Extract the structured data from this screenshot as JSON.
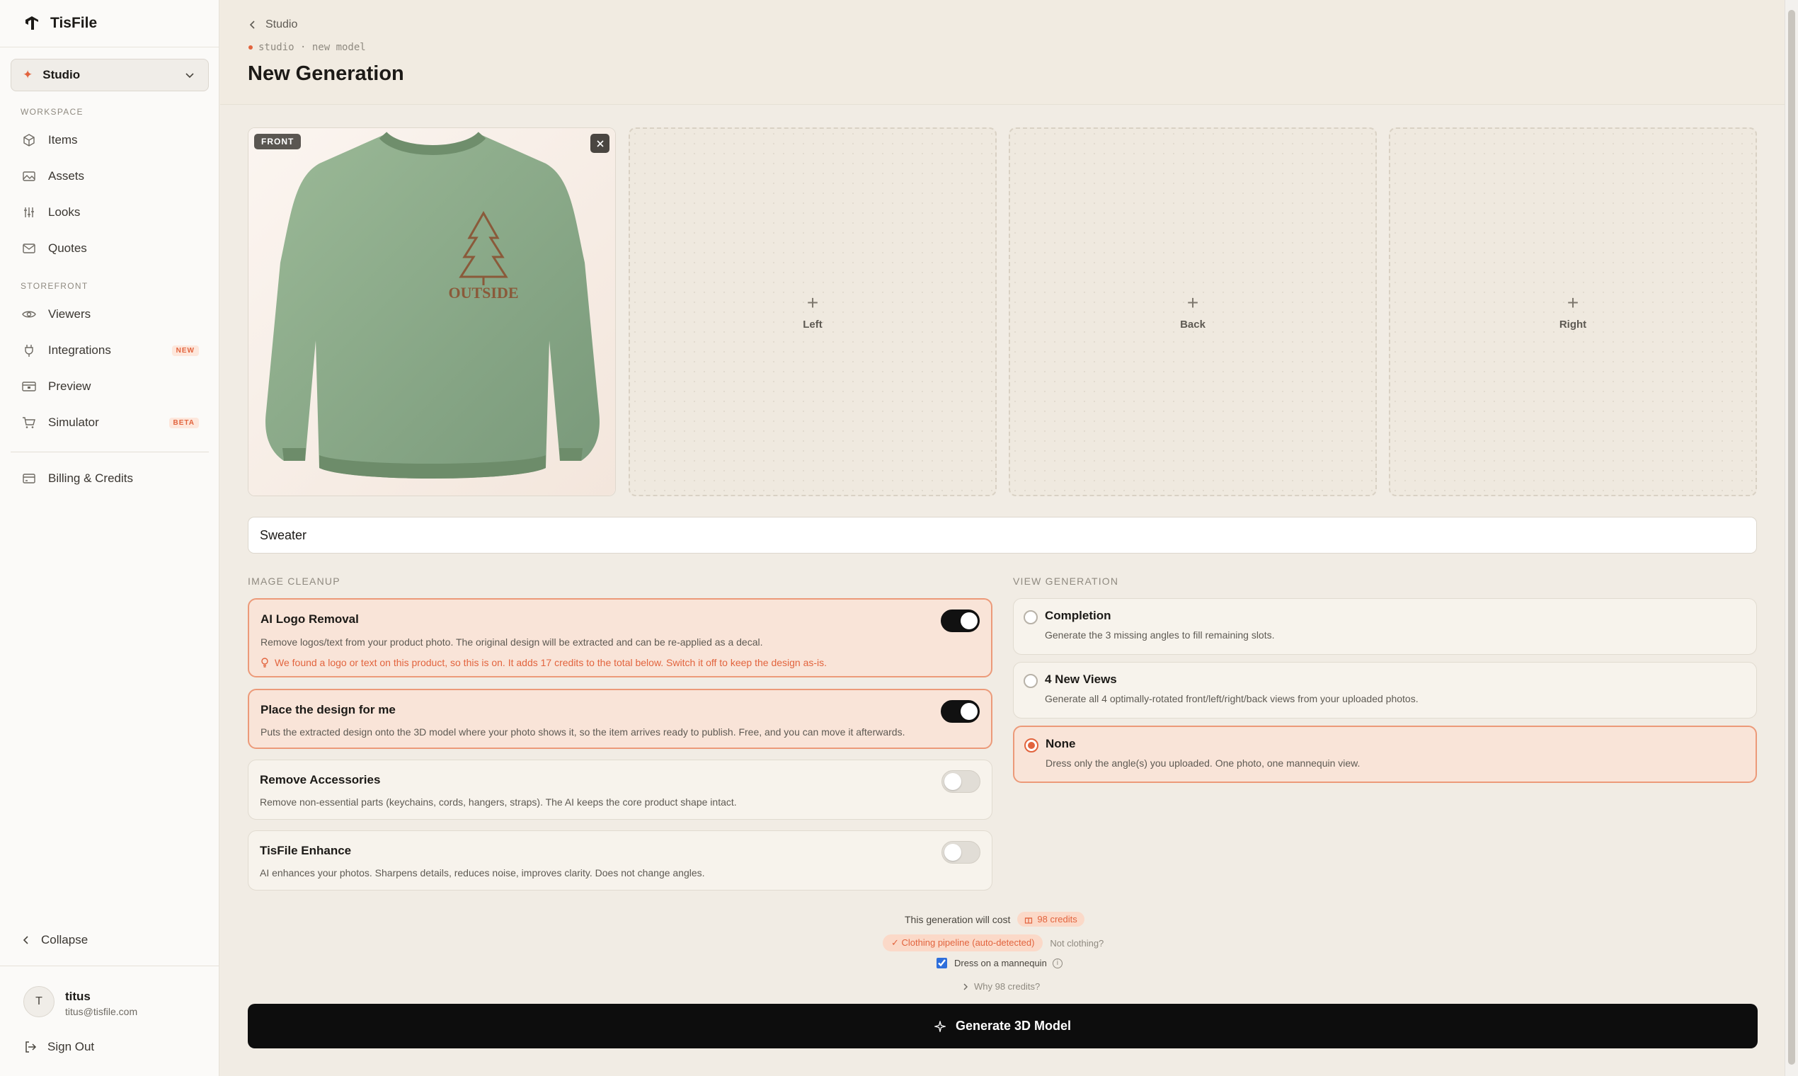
{
  "brand": {
    "name": "TisFile"
  },
  "sidebar": {
    "studio_select": "Studio",
    "section_workspace": "WORKSPACE",
    "section_storefront": "STOREFRONT",
    "workspace_items": [
      {
        "label": "Items",
        "icon": "cube-icon"
      },
      {
        "label": "Assets",
        "icon": "image-icon"
      },
      {
        "label": "Looks",
        "icon": "sliders-icon"
      },
      {
        "label": "Quotes",
        "icon": "mail-icon"
      }
    ],
    "storefront_items": [
      {
        "label": "Viewers",
        "icon": "eye-icon"
      },
      {
        "label": "Integrations",
        "icon": "plug-icon",
        "badge": "NEW"
      },
      {
        "label": "Preview",
        "icon": "preview-icon"
      },
      {
        "label": "Simulator",
        "icon": "cart-icon",
        "badge": "BETA"
      }
    ],
    "billing": "Billing & Credits",
    "collapse": "Collapse",
    "user": {
      "initial": "T",
      "name": "titus",
      "email": "titus@tisfile.com"
    },
    "sign_out": "Sign Out"
  },
  "header": {
    "back": "Studio",
    "crumb": "studio · new model",
    "title": "New Generation"
  },
  "slots": {
    "front_badge": "FRONT",
    "empty": [
      "Left",
      "Back",
      "Right"
    ]
  },
  "name_input": {
    "value": "Sweater"
  },
  "image_cleanup": {
    "label": "IMAGE CLEANUP",
    "options": [
      {
        "title": "AI Logo Removal",
        "desc": "Remove logos/text from your product photo. The original design will be extracted and can be re-applied as a decal.",
        "warning": "We found a logo or text on this product, so this is on. It adds 17 credits to the total below. Switch it off to keep the design as-is.",
        "on": true
      },
      {
        "title": "Place the design for me",
        "desc": "Puts the extracted design onto the 3D model where your photo shows it, so the item arrives ready to publish. Free, and you can move it afterwards.",
        "on": true
      },
      {
        "title": "Remove Accessories",
        "desc": "Remove non-essential parts (keychains, cords, hangers, straps). The AI keeps the core product shape intact.",
        "on": false
      },
      {
        "title": "TisFile Enhance",
        "desc": "AI enhances your photos. Sharpens details, reduces noise, improves clarity. Does not change angles.",
        "on": false
      }
    ]
  },
  "view_generation": {
    "label": "VIEW GENERATION",
    "options": [
      {
        "title": "Completion",
        "desc": "Generate the 3 missing angles to fill remaining slots.",
        "selected": false
      },
      {
        "title": "4 New Views",
        "desc": "Generate all 4 optimally-rotated front/left/right/back views from your uploaded photos.",
        "selected": false
      },
      {
        "title": "None",
        "desc": "Dress only the angle(s) you uploaded. One photo, one mannequin view.",
        "selected": true
      }
    ]
  },
  "summary": {
    "cost_text": "This generation will cost",
    "credits": "98 credits",
    "pipeline": "✓ Clothing pipeline (auto-detected)",
    "not_clothing": "Not clothing?",
    "mannequin": "Dress on a mannequin",
    "why": "Why 98 credits?"
  },
  "generate_button": "Generate 3D Model",
  "colors": {
    "accent": "#e2643e",
    "active_bg": "#f9e4d8",
    "button": "#0d0d0d"
  }
}
